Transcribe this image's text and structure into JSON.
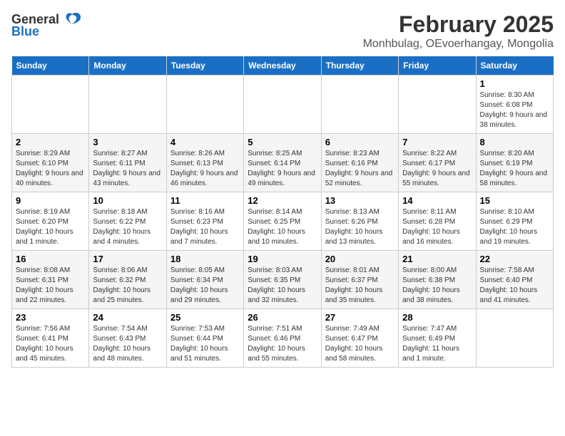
{
  "header": {
    "logo_general": "General",
    "logo_blue": "Blue",
    "title": "February 2025",
    "subtitle": "Monhbulag, OEvoerhangay, Mongolia"
  },
  "weekdays": [
    "Sunday",
    "Monday",
    "Tuesday",
    "Wednesday",
    "Thursday",
    "Friday",
    "Saturday"
  ],
  "weeks": [
    [
      {
        "day": "",
        "info": ""
      },
      {
        "day": "",
        "info": ""
      },
      {
        "day": "",
        "info": ""
      },
      {
        "day": "",
        "info": ""
      },
      {
        "day": "",
        "info": ""
      },
      {
        "day": "",
        "info": ""
      },
      {
        "day": "1",
        "info": "Sunrise: 8:30 AM\nSunset: 6:08 PM\nDaylight: 9 hours and 38 minutes."
      }
    ],
    [
      {
        "day": "2",
        "info": "Sunrise: 8:29 AM\nSunset: 6:10 PM\nDaylight: 9 hours and 40 minutes."
      },
      {
        "day": "3",
        "info": "Sunrise: 8:27 AM\nSunset: 6:11 PM\nDaylight: 9 hours and 43 minutes."
      },
      {
        "day": "4",
        "info": "Sunrise: 8:26 AM\nSunset: 6:13 PM\nDaylight: 9 hours and 46 minutes."
      },
      {
        "day": "5",
        "info": "Sunrise: 8:25 AM\nSunset: 6:14 PM\nDaylight: 9 hours and 49 minutes."
      },
      {
        "day": "6",
        "info": "Sunrise: 8:23 AM\nSunset: 6:16 PM\nDaylight: 9 hours and 52 minutes."
      },
      {
        "day": "7",
        "info": "Sunrise: 8:22 AM\nSunset: 6:17 PM\nDaylight: 9 hours and 55 minutes."
      },
      {
        "day": "8",
        "info": "Sunrise: 8:20 AM\nSunset: 6:19 PM\nDaylight: 9 hours and 58 minutes."
      }
    ],
    [
      {
        "day": "9",
        "info": "Sunrise: 8:19 AM\nSunset: 6:20 PM\nDaylight: 10 hours and 1 minute."
      },
      {
        "day": "10",
        "info": "Sunrise: 8:18 AM\nSunset: 6:22 PM\nDaylight: 10 hours and 4 minutes."
      },
      {
        "day": "11",
        "info": "Sunrise: 8:16 AM\nSunset: 6:23 PM\nDaylight: 10 hours and 7 minutes."
      },
      {
        "day": "12",
        "info": "Sunrise: 8:14 AM\nSunset: 6:25 PM\nDaylight: 10 hours and 10 minutes."
      },
      {
        "day": "13",
        "info": "Sunrise: 8:13 AM\nSunset: 6:26 PM\nDaylight: 10 hours and 13 minutes."
      },
      {
        "day": "14",
        "info": "Sunrise: 8:11 AM\nSunset: 6:28 PM\nDaylight: 10 hours and 16 minutes."
      },
      {
        "day": "15",
        "info": "Sunrise: 8:10 AM\nSunset: 6:29 PM\nDaylight: 10 hours and 19 minutes."
      }
    ],
    [
      {
        "day": "16",
        "info": "Sunrise: 8:08 AM\nSunset: 6:31 PM\nDaylight: 10 hours and 22 minutes."
      },
      {
        "day": "17",
        "info": "Sunrise: 8:06 AM\nSunset: 6:32 PM\nDaylight: 10 hours and 25 minutes."
      },
      {
        "day": "18",
        "info": "Sunrise: 8:05 AM\nSunset: 6:34 PM\nDaylight: 10 hours and 29 minutes."
      },
      {
        "day": "19",
        "info": "Sunrise: 8:03 AM\nSunset: 6:35 PM\nDaylight: 10 hours and 32 minutes."
      },
      {
        "day": "20",
        "info": "Sunrise: 8:01 AM\nSunset: 6:37 PM\nDaylight: 10 hours and 35 minutes."
      },
      {
        "day": "21",
        "info": "Sunrise: 8:00 AM\nSunset: 6:38 PM\nDaylight: 10 hours and 38 minutes."
      },
      {
        "day": "22",
        "info": "Sunrise: 7:58 AM\nSunset: 6:40 PM\nDaylight: 10 hours and 41 minutes."
      }
    ],
    [
      {
        "day": "23",
        "info": "Sunrise: 7:56 AM\nSunset: 6:41 PM\nDaylight: 10 hours and 45 minutes."
      },
      {
        "day": "24",
        "info": "Sunrise: 7:54 AM\nSunset: 6:43 PM\nDaylight: 10 hours and 48 minutes."
      },
      {
        "day": "25",
        "info": "Sunrise: 7:53 AM\nSunset: 6:44 PM\nDaylight: 10 hours and 51 minutes."
      },
      {
        "day": "26",
        "info": "Sunrise: 7:51 AM\nSunset: 6:46 PM\nDaylight: 10 hours and 55 minutes."
      },
      {
        "day": "27",
        "info": "Sunrise: 7:49 AM\nSunset: 6:47 PM\nDaylight: 10 hours and 58 minutes."
      },
      {
        "day": "28",
        "info": "Sunrise: 7:47 AM\nSunset: 6:49 PM\nDaylight: 11 hours and 1 minute."
      },
      {
        "day": "",
        "info": ""
      }
    ]
  ]
}
